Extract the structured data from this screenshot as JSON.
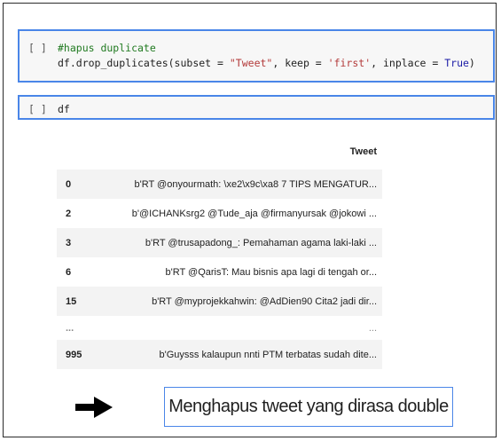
{
  "cells": [
    {
      "prompt": "[ ]",
      "comment": "#hapus duplicate",
      "code_prefix": "df.drop_duplicates(subset = ",
      "subset_value": "\"Tweet\"",
      "keep_part": ", keep = ",
      "keep_value": "'first'",
      "inplace_part": ", inplace = ",
      "inplace_value": "True",
      "code_suffix": ")"
    },
    {
      "prompt": "[ ]",
      "code": "df"
    }
  ],
  "table": {
    "columns": [
      "",
      "Tweet"
    ],
    "rows": [
      {
        "index": "0",
        "tweet": "b'RT @onyourmath: \\xe2\\x9c\\xa8 7 TIPS MENGATUR..."
      },
      {
        "index": "2",
        "tweet": "b'@ICHANKsrg2 @Tude_aja @firmanyursak @jokowi ..."
      },
      {
        "index": "3",
        "tweet": "b'RT @trusapadong_: Pemahaman agama laki-laki ..."
      },
      {
        "index": "6",
        "tweet": "b'RT @QarisT: Mau bisnis apa lagi di tengah or..."
      },
      {
        "index": "15",
        "tweet": "b'RT @myprojekkahwin: @AdDien90 Cita2 jadi dir..."
      },
      {
        "index": "...",
        "tweet": "..."
      },
      {
        "index": "995",
        "tweet": "b'Guysss kalaupun nnti PTM terbatas sudah dite..."
      }
    ]
  },
  "annotation": {
    "icon": "right-arrow-icon",
    "text": "Menghapus tweet yang dirasa double",
    "accent": "#4a86e8"
  }
}
